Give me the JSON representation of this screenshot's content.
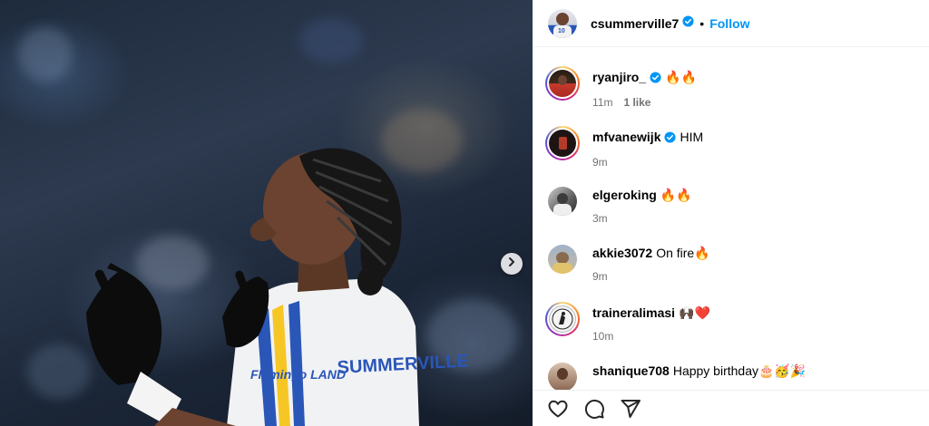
{
  "post": {
    "author": "csummerville7",
    "follow_label": "Follow",
    "separator": "•",
    "image_description_icon": "photo"
  },
  "comments": [
    {
      "username": "ryanjiro_",
      "verified": true,
      "text": "🔥🔥",
      "time": "11m",
      "likes": "1 like",
      "story_ring": true,
      "avatar_color": "#c83a2c"
    },
    {
      "username": "mfvanewijk",
      "verified": true,
      "text": "HIM",
      "time": "9m",
      "likes": "",
      "story_ring": true,
      "avatar_color": "#2a1c1c"
    },
    {
      "username": "elgeroking",
      "verified": false,
      "text": "🔥🔥",
      "time": "3m",
      "likes": "",
      "story_ring": false,
      "avatar_color": "#777777"
    },
    {
      "username": "akkie3072",
      "verified": false,
      "text": "On fire🔥",
      "time": "9m",
      "likes": "",
      "story_ring": false,
      "avatar_color": "#b8a48c"
    },
    {
      "username": "traineralimasi",
      "verified": false,
      "text": "🙌🏿❤️",
      "time": "10m",
      "likes": "",
      "story_ring": true,
      "avatar_color": "#f2f2f2"
    },
    {
      "username": "shanique708",
      "verified": false,
      "text": "Happy birthday🎂🥳🎉",
      "time": "",
      "likes": "",
      "story_ring": false,
      "avatar_color": "#6b4a3a"
    }
  ],
  "colors": {
    "link": "#0095f6",
    "verified": "#0095f6",
    "meta": "#737373"
  },
  "actions": {
    "like_icon": "heart-icon",
    "comment_icon": "comment-icon",
    "share_icon": "share-icon"
  },
  "photo": {
    "jersey_name": "SUMMERVILLE",
    "sponsor": "Flamingo LAND"
  }
}
